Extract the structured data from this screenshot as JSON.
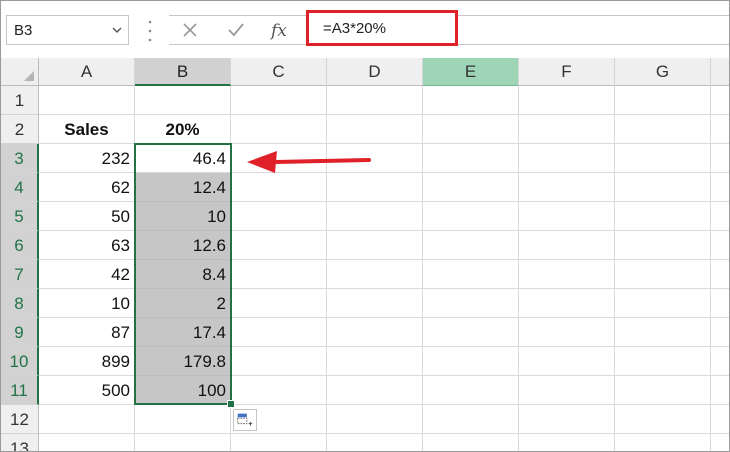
{
  "name_box": {
    "value": "B3"
  },
  "formula_bar": {
    "formula": "=A3*20%"
  },
  "columns": [
    "A",
    "B",
    "C",
    "D",
    "E",
    "F",
    "G"
  ],
  "rows": [
    "1",
    "2",
    "3",
    "4",
    "5",
    "6",
    "7",
    "8",
    "9",
    "10",
    "11",
    "12",
    "13"
  ],
  "cells": {
    "A2": "Sales",
    "B2": "20%",
    "A3": "232",
    "B3": "46.4",
    "A4": "62",
    "B4": "12.4",
    "A5": "50",
    "B5": "10",
    "A6": "63",
    "B6": "12.6",
    "A7": "42",
    "B7": "8.4",
    "A8": "10",
    "B8": "2",
    "A9": "87",
    "B9": "17.4",
    "A10": "899",
    "B10": "179.8",
    "A11": "500",
    "B11": "100"
  },
  "colors": {
    "selection": "#217346",
    "highlight_column": "#9fd5b7",
    "annotation": "#e0212a"
  }
}
